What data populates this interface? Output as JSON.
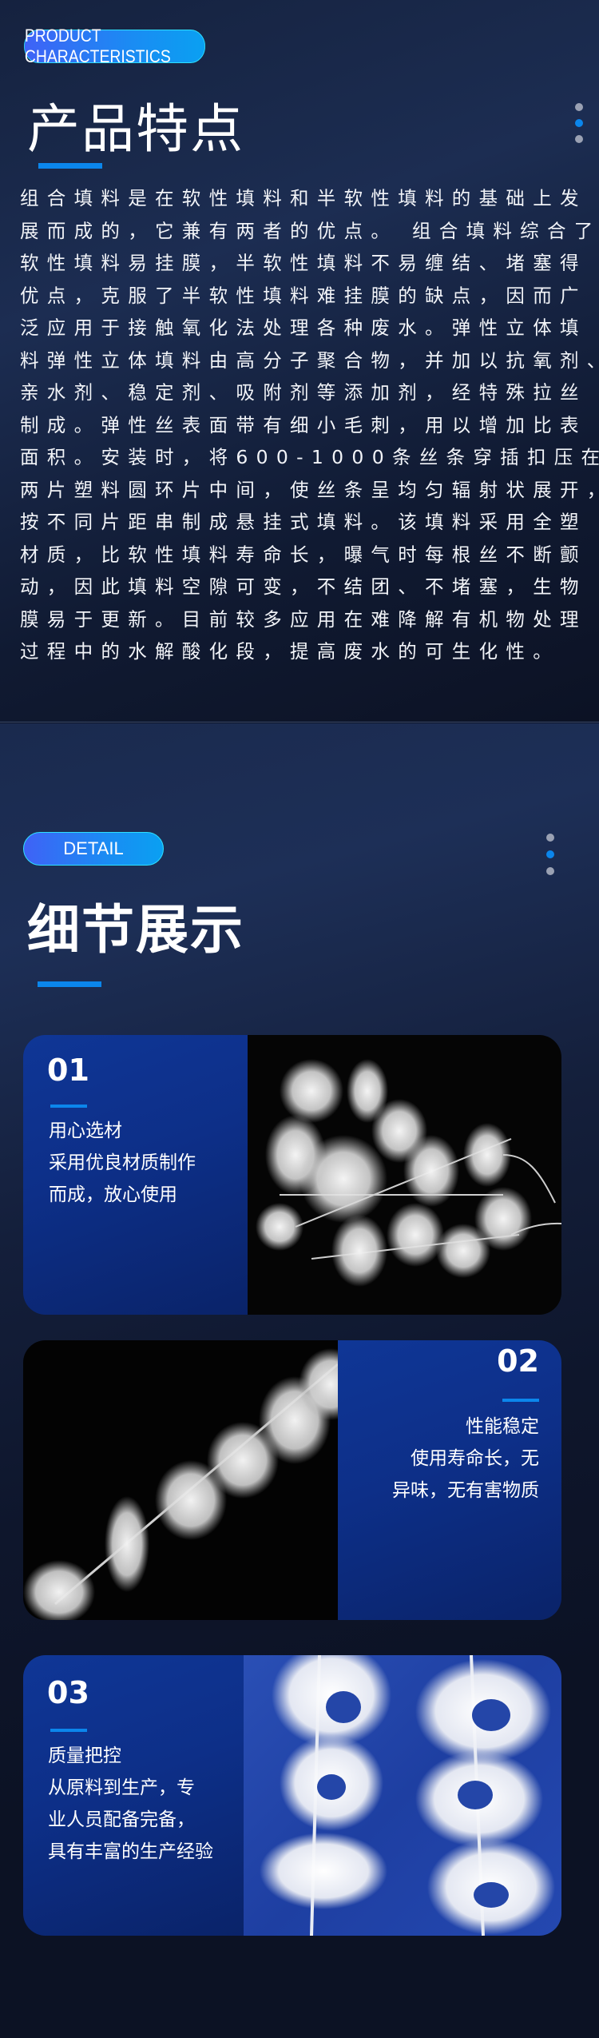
{
  "characteristics": {
    "badge": "PRODUCT CHARACTERISTICS",
    "title": "产品特点",
    "pager": {
      "count": 3,
      "active_index": 1
    },
    "description_lines": [
      "组合填料是在软性填料和半软性填料的基础上发",
      "展而成的，它兼有两者的优点。 组合填料综合了",
      "软性填料易挂膜，半软性填料不易缠结、堵塞得",
      "优点，克服了半软性填料难挂膜的缺点，因而广",
      "泛应用于接触氧化法处理各种废水。弹性立体填",
      "料弹性立体填料由高分子聚合物，并加以抗氧剂、",
      "亲水剂、稳定剂、吸附剂等添加剂，经特殊拉丝",
      "制成。弹性丝表面带有细小毛刺，用以增加比表",
      "面积。安装时，将600-1000条丝条穿插扣压在",
      "两片塑料圆环片中间，使丝条呈均匀辐射状展开，",
      "按不同片距串制成悬挂式填料。该填料采用全塑",
      "材质，比软性填料寿命长，曝气时每根丝不断颤",
      "动，因此填料空隙可变，不结团、不堵塞，生物",
      "膜易于更新。目前较多应用在难降解有机物处理",
      "过程中的水解酸化段，提高废水的可生化性。"
    ]
  },
  "detail": {
    "badge": "DETAIL",
    "title": "细节展示",
    "pager": {
      "count": 3,
      "active_index": 1
    },
    "cards": [
      {
        "number": "01",
        "lines": [
          "用心选材",
          "采用优良材质制作",
          "而成，放心使用"
        ],
        "photo": "white-fiber-packing-cluster-on-black"
      },
      {
        "number": "02",
        "lines": [
          "性能稳定",
          "使用寿命长，无",
          "异味，无有害物质"
        ],
        "photo": "fiber-packing-string-diagonal-on-black"
      },
      {
        "number": "03",
        "lines": [
          "质量把控",
          "从原料到生产，专",
          "业人员配备完备，",
          "具有丰富的生产经验"
        ],
        "photo": "two-fiber-packing-strings-on-blue-fabric"
      }
    ]
  },
  "colors": {
    "accent": "#0b86ec",
    "badge_gradient_start": "#3f62f6",
    "badge_gradient_end": "#0aa0f2",
    "badge_border": "#2ee0ff",
    "card_panel": "#0d2f88",
    "background_dark": "#0c1224"
  }
}
